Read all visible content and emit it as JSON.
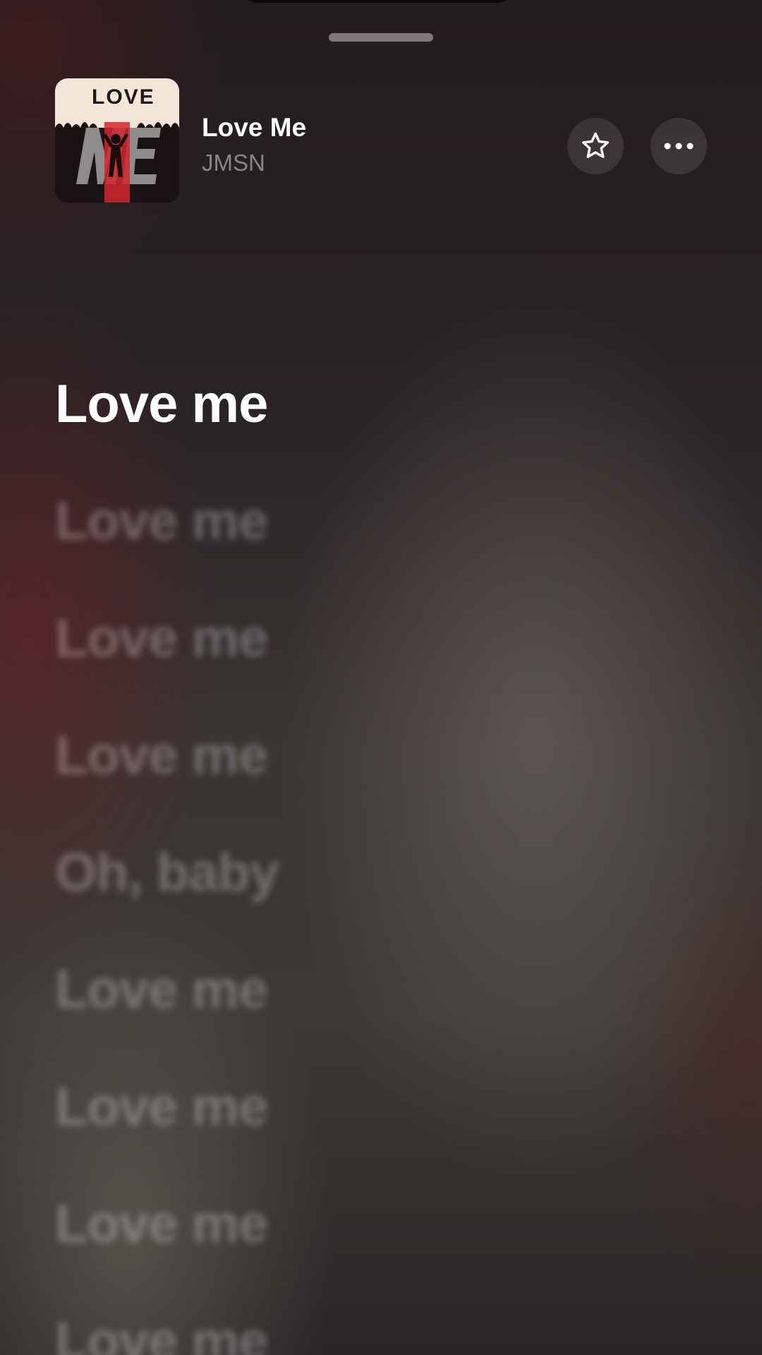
{
  "now_playing": {
    "title": "Love Me",
    "artist": "JMSN",
    "artwork_text": "LOVE ME",
    "favorite_icon": "star-icon",
    "more_icon": "ellipsis-icon"
  },
  "lyrics": {
    "lines": [
      "Love me",
      "Love me",
      "Love me",
      "Love me",
      "Oh, baby",
      "Love me",
      "Love me",
      "Love me",
      "Love me"
    ],
    "active_index": 0
  },
  "colors": {
    "background_dark": "#201c1d",
    "accent_red": "#d4262e",
    "secondary_text": "#8a8586"
  }
}
